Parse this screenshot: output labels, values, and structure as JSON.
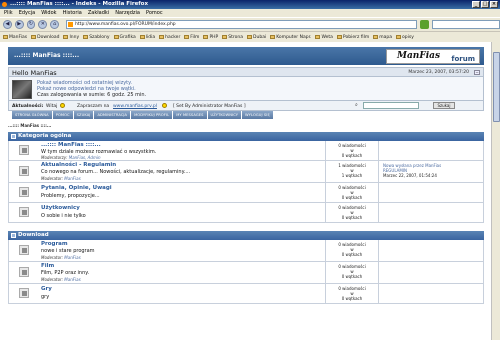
{
  "window": {
    "title": "...:::: ManFias ::::... - Indeks - Mozilla Firefox",
    "controls": [
      "_",
      "□",
      "×"
    ]
  },
  "menu": [
    "Plik",
    "Edycja",
    "Widok",
    "Historia",
    "Zakładki",
    "Narzędzia",
    "Pomoc"
  ],
  "address": {
    "url": "http://www.manfias.ovo.pl/FORUM/index.php"
  },
  "bookmarks": [
    "ManFias",
    "Download",
    "Inny",
    "Szablony",
    "Grafika",
    "lidia",
    "hacker",
    "Film",
    "PHP",
    "Strona",
    "Dubai",
    "Komputer Napr.",
    "Weta",
    "Pobierz film",
    "mapa",
    "opisy"
  ],
  "forum": {
    "title": "...:::: ManFias ::::...",
    "logo_main": "ManFias",
    "logo_sub": "forum",
    "hello": "Hello ManFias",
    "date": "Marzec 23, 2007, 03:57:20",
    "info_lines": [
      "Pokaż wiadomości od ostatniej wizyty.",
      "Pokaż nowe odpowiedzi na twoje wątki.",
      "Czas zalogowania w sumie: 6 godz. 25 min."
    ],
    "action_label": "Aktualności:",
    "action_welcome": "Witaj",
    "action_invite_prefix": "Zapraszam na",
    "action_invite_link": "www.manfias.prv.pl",
    "action_set": "[ Set By Administrator ManFias ]",
    "search_button": "Szukaj",
    "tabs": [
      "STRONA GŁÓWNA",
      "POMOC",
      "SZUKAJ",
      "ADMINISTRACJA",
      "MODYFIKUJ PROFIL",
      "MY MESSAGES",
      "UŻYTKOWNICY",
      "WYLOGUJ SIĘ"
    ],
    "breadcrumb": "...:::: ManFias ::::..."
  },
  "categories": [
    {
      "name": "Kategoria ogólna",
      "boards": [
        {
          "name": "...:::: ManFias ::::...",
          "desc": "W tym dziale możesz rozmawiać o wszystkim.",
          "mod_label": "Moderatorzy:",
          "mods": "ManFias, Admin",
          "posts": "0 wiadomości",
          "sep": "w",
          "topics": "0 wątkach",
          "last": []
        },
        {
          "name": "Aktualności - Regulamin",
          "desc": "Co nowego na forum... Nowości, aktualizacje, regulaminy....",
          "mod_label": "Moderator:",
          "mods": "ManFias",
          "posts": "1 wiadomości",
          "sep": "w",
          "topics": "1 wątkach",
          "last": [
            "Nowa wysłana przez ManFias",
            "REGULAMIN",
            "Marzec 22, 2007, 01:54:24"
          ]
        },
        {
          "name": "Pytania, Opinie, Uwagi",
          "desc": "Problemy, propozycje...",
          "mod_label": "",
          "mods": "",
          "posts": "0 wiadomości",
          "sep": "w",
          "topics": "0 wątkach",
          "last": []
        },
        {
          "name": "Użytkownicy",
          "desc": "O sobie i nie tylko",
          "mod_label": "",
          "mods": "",
          "posts": "0 wiadomości",
          "sep": "w",
          "topics": "0 wątkach",
          "last": []
        }
      ]
    },
    {
      "name": "Download",
      "boards": [
        {
          "name": "Program",
          "desc": "nowe i stare program",
          "mod_label": "Moderator:",
          "mods": "ManFias",
          "posts": "0 wiadomości",
          "sep": "w",
          "topics": "0 wątkach",
          "last": []
        },
        {
          "name": "Film",
          "desc": "Film, P2P oraz inny.",
          "mod_label": "Moderator:",
          "mods": "ManFias",
          "posts": "0 wiadomości",
          "sep": "w",
          "topics": "0 wątkach",
          "last": []
        },
        {
          "name": "Gry",
          "desc": "gry",
          "mod_label": "",
          "mods": "",
          "posts": "0 wiadomości",
          "sep": "w",
          "topics": "0 wątkach",
          "last": []
        }
      ]
    }
  ]
}
